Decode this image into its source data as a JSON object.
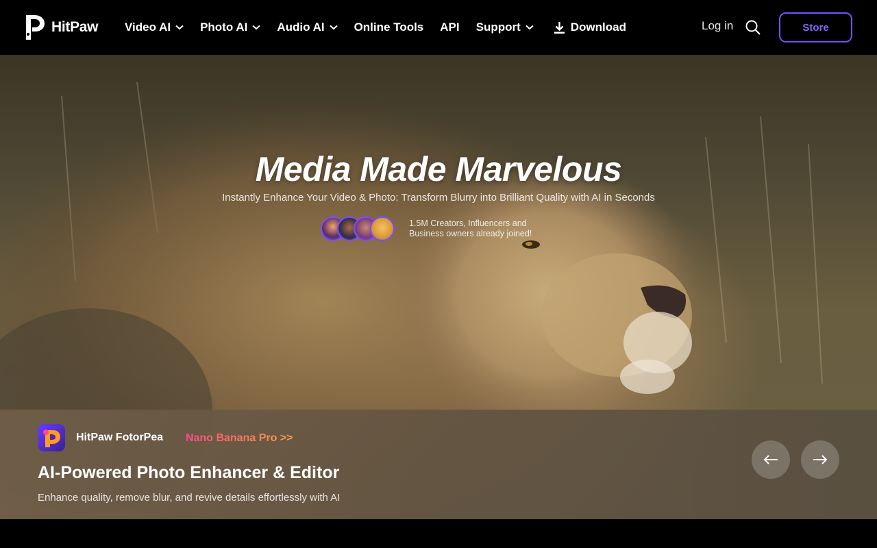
{
  "header": {
    "logo_text": "HitPaw",
    "nav": [
      {
        "label": "Video AI",
        "has_dropdown": true
      },
      {
        "label": "Photo AI",
        "has_dropdown": true
      },
      {
        "label": "Audio AI",
        "has_dropdown": true
      },
      {
        "label": "Online Tools",
        "has_dropdown": false
      },
      {
        "label": "API",
        "has_dropdown": false
      },
      {
        "label": "Support",
        "has_dropdown": true
      },
      {
        "label": "Download",
        "icon": "download-icon"
      }
    ],
    "login_label": "Log in",
    "search_icon": "search-icon",
    "store_label": "Store"
  },
  "hero": {
    "title": "Media Made Marvelous",
    "subtitle": "Instantly Enhance Your Video & Photo: Transform Blurry into Brilliant Quality with AI in Seconds",
    "social_proof_line1": "1.5M Creators, Influencers and",
    "social_proof_line2": "Business owners already joined!"
  },
  "panel": {
    "app_icon": "fotorpea-app-icon",
    "app_name": "HitPaw FotorPea",
    "promo_link": "Nano Banana Pro >>",
    "title": "AI-Powered Photo Enhancer & Editor",
    "description": "Enhance quality, remove blur, and revive details effortlessly with AI",
    "prev_icon": "arrow-left-icon",
    "next_icon": "arrow-right-icon"
  },
  "colors": {
    "accent": "#7b4dff",
    "promo_start": "#ff4a8a",
    "promo_end": "#ffa040",
    "header_bg": "#000000"
  }
}
